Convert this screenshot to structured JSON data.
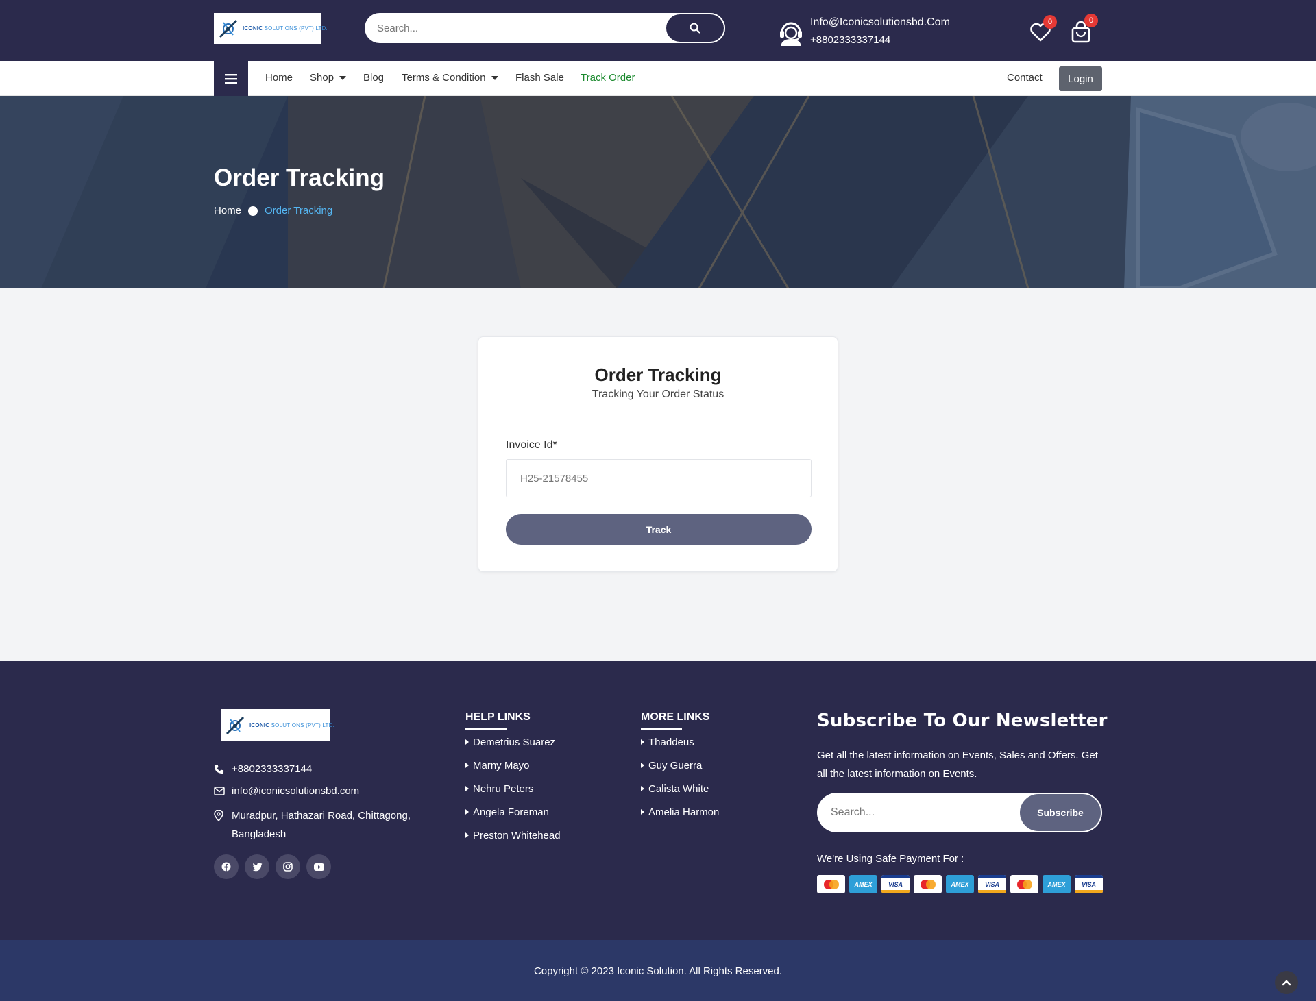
{
  "header": {
    "logo": {
      "brand": "ICONIC",
      "suffix": "SOLUTIONS (PVT) LTD."
    },
    "search": {
      "placeholder": "Search..."
    },
    "contact": {
      "email": "Info@Iconicsolutionsbd.Com",
      "phone": "+8802333337144"
    },
    "wishlist": {
      "count": "0"
    },
    "cart": {
      "count": "0"
    }
  },
  "nav": {
    "items": [
      {
        "label": "Home"
      },
      {
        "label": "Shop"
      },
      {
        "label": "Blog"
      },
      {
        "label": "Terms & Condition"
      },
      {
        "label": "Flash Sale"
      },
      {
        "label": "Track Order"
      }
    ],
    "contact": "Contact",
    "login": "Login"
  },
  "hero": {
    "title": "Order Tracking",
    "breadcrumb": {
      "home": "Home",
      "current": "Order Tracking"
    }
  },
  "tracking": {
    "title": "Order Tracking",
    "subtitle": "Tracking Your Order Status",
    "invoice_label": "Invoice Id*",
    "invoice_placeholder": "H25-21578455",
    "button": "Track"
  },
  "footer": {
    "logo": {
      "brand": "ICONIC",
      "suffix": "SOLUTIONS (PVT) LTD."
    },
    "phone": "+8802333337144",
    "email": "info@iconicsolutionsbd.com",
    "address_line1": "Muradpur, Hathazari Road, Chittagong,",
    "address_line2": "Bangladesh",
    "help": {
      "heading": "HELP LINKS",
      "links": [
        "Demetrius Suarez",
        "Marny Mayo",
        "Nehru Peters",
        "Angela Foreman",
        "Preston Whitehead"
      ]
    },
    "more": {
      "heading": "MORE LINKS",
      "links": [
        "Thaddeus",
        "Guy Guerra",
        "Calista White",
        "Amelia Harmon"
      ]
    },
    "newsletter": {
      "title": "Subscribe To Our Newsletter",
      "text": "Get all the latest information on Events, Sales and Offers. Get all the latest information on Events.",
      "placeholder": "Search...",
      "button": "Subscribe"
    },
    "payment_label": "We're Using Safe Payment For :",
    "payments": [
      "mastercard",
      "AMEX",
      "VISA",
      "mastercard",
      "AMEX",
      "VISA",
      "mastercard",
      "AMEX",
      "VISA"
    ],
    "copyright": "Copyright © 2023 Iconic Solution. All Rights Reserved."
  },
  "colors": {
    "header_bg": "#2b2a4c",
    "accent_active": "#1b8a2e",
    "breadcrumb_current": "#55b6f2",
    "button": "#5e6380",
    "badge": "#e53935",
    "copyright_bg": "#2c3867"
  }
}
